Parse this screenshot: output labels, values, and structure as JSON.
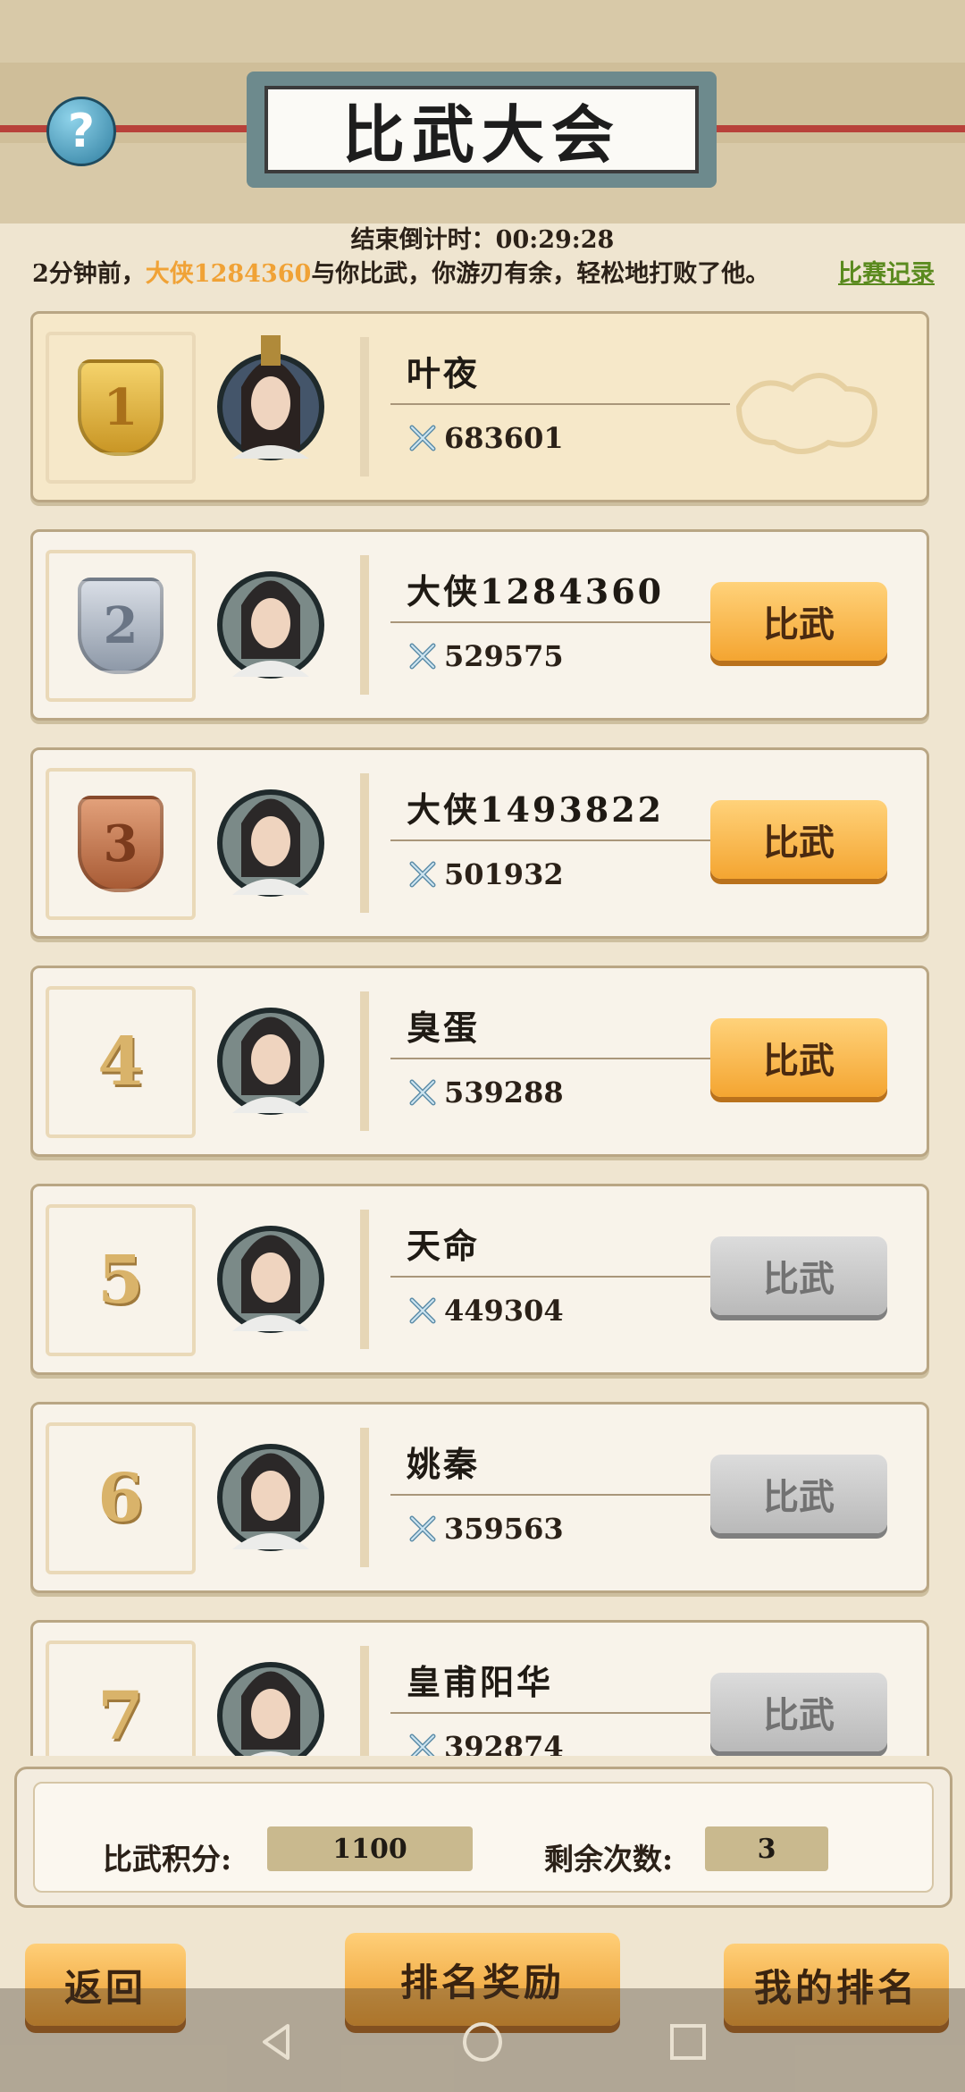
{
  "header": {
    "title": "比武大会",
    "help_icon": "question-icon",
    "countdown_label": "结束倒计时：",
    "countdown_value": "00:29:28"
  },
  "news": {
    "prefix": "2分钟前，",
    "player": "大侠1284360",
    "suffix": "与你比武，你游刃有余，轻松地打败了他。",
    "link": "比赛记录"
  },
  "ranking": [
    {
      "rank": "1",
      "medal": "gold",
      "name": "叶夜",
      "power": "683601",
      "button": ""
    },
    {
      "rank": "2",
      "medal": "silver",
      "name": "大侠1284360",
      "power": "529575",
      "button": "比武",
      "enabled": true
    },
    {
      "rank": "3",
      "medal": "bronze",
      "name": "大侠1493822",
      "power": "501932",
      "button": "比武",
      "enabled": true
    },
    {
      "rank": "4",
      "medal": "",
      "name": "臭蛋",
      "power": "539288",
      "button": "比武",
      "enabled": true
    },
    {
      "rank": "5",
      "medal": "",
      "name": "天命",
      "power": "449304",
      "button": "比武",
      "enabled": false
    },
    {
      "rank": "6",
      "medal": "",
      "name": "姚秦",
      "power": "359563",
      "button": "比武",
      "enabled": false
    },
    {
      "rank": "7",
      "medal": "",
      "name": "皇甫阳华",
      "power": "392874",
      "button": "比武",
      "enabled": false
    }
  ],
  "stats": {
    "score_label": "比武积分:",
    "score_value": "1100",
    "remaining_label": "剩余次数:",
    "remaining_value": "3"
  },
  "footer": {
    "back": "返回",
    "rewards": "排名奖励",
    "my_rank": "我的排名"
  },
  "colors": {
    "accent_orange": "#f4a531",
    "highlight_name": "#f0a236",
    "link_green": "#5a8a1e",
    "disabled_gray": "#b9b9b9"
  }
}
